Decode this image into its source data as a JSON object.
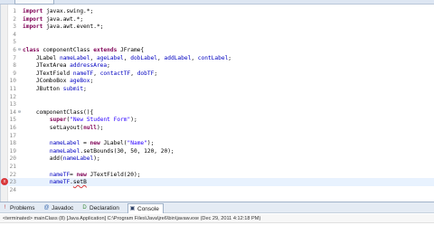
{
  "editor": {
    "lines": [
      {
        "n": "1",
        "html": "<span class='kw'>import</span> javax.swing.*;"
      },
      {
        "n": "2",
        "html": "<span class='kw'>import</span> java.awt.*;"
      },
      {
        "n": "3",
        "html": "<span class='kw'>import</span> java.awt.event.*;"
      },
      {
        "n": "4",
        "html": ""
      },
      {
        "n": "5",
        "html": ""
      },
      {
        "n": "6",
        "html": "<span class='kw'>class</span> componentClass <span class='kw'>extends</span> JFrame{"
      },
      {
        "n": "7",
        "html": "    JLabel <span class='fld'>nameLabel</span>, <span class='fld'>ageLabel</span>, <span class='fld'>dobLabel</span>, <span class='fld'>addLabel</span>, <span class='fld'>contLabel</span>;"
      },
      {
        "n": "8",
        "html": "    JTextArea <span class='fld'>addressArea</span>;"
      },
      {
        "n": "9",
        "html": "    JTextField <span class='fld'>nameTF</span>, <span class='fld'>contactTF</span>, <span class='fld'>dobTF</span>;"
      },
      {
        "n": "10",
        "html": "    JComboBox <span class='fld'>ageBox</span>;"
      },
      {
        "n": "11",
        "html": "    JButton <span class='fld'>submit</span>;"
      },
      {
        "n": "12",
        "html": ""
      },
      {
        "n": "13",
        "html": ""
      },
      {
        "n": "14",
        "html": "    componentClass(){"
      },
      {
        "n": "15",
        "html": "        <span class='kw'>super</span>(<span class='str'>\"New Student Form\"</span>);"
      },
      {
        "n": "16",
        "html": "        setLayout(<span class='kw'>null</span>);"
      },
      {
        "n": "17",
        "html": ""
      },
      {
        "n": "18",
        "html": "        <span class='fld'>nameLabel</span> = <span class='kw'>new</span> JLabel(<span class='str'>\"Name\"</span>);"
      },
      {
        "n": "19",
        "html": "        <span class='fld'>nameLabel</span>.setBounds(30, 50, 120, 20);"
      },
      {
        "n": "20",
        "html": "        add(<span class='fld'>nameLabel</span>);"
      },
      {
        "n": "21",
        "html": ""
      },
      {
        "n": "22",
        "html": "        <span class='fld'>nameTF</span>= <span class='kw'>new</span> JTextField(20);"
      },
      {
        "n": "23",
        "html": "        <span class='fld'>nameTF</span>.<span class='err-underline'>setB</span>"
      },
      {
        "n": "24",
        "html": ""
      }
    ]
  },
  "views": {
    "tabs": [
      {
        "icon": "!",
        "label": "Problems",
        "color": "#c24040"
      },
      {
        "icon": "@",
        "label": "Javadoc",
        "color": "#3a6ab0"
      },
      {
        "icon": "D",
        "label": "Declaration",
        "color": "#3a8a3a"
      },
      {
        "icon": "▣",
        "label": "Console",
        "color": "#33466b"
      }
    ]
  },
  "console": {
    "status": "<terminated> mainClass (8) [Java Application] C:\\Program Files\\Java\\jre6\\bin\\javaw.exe (Dec 29, 2011 4:12:18 PM)"
  }
}
